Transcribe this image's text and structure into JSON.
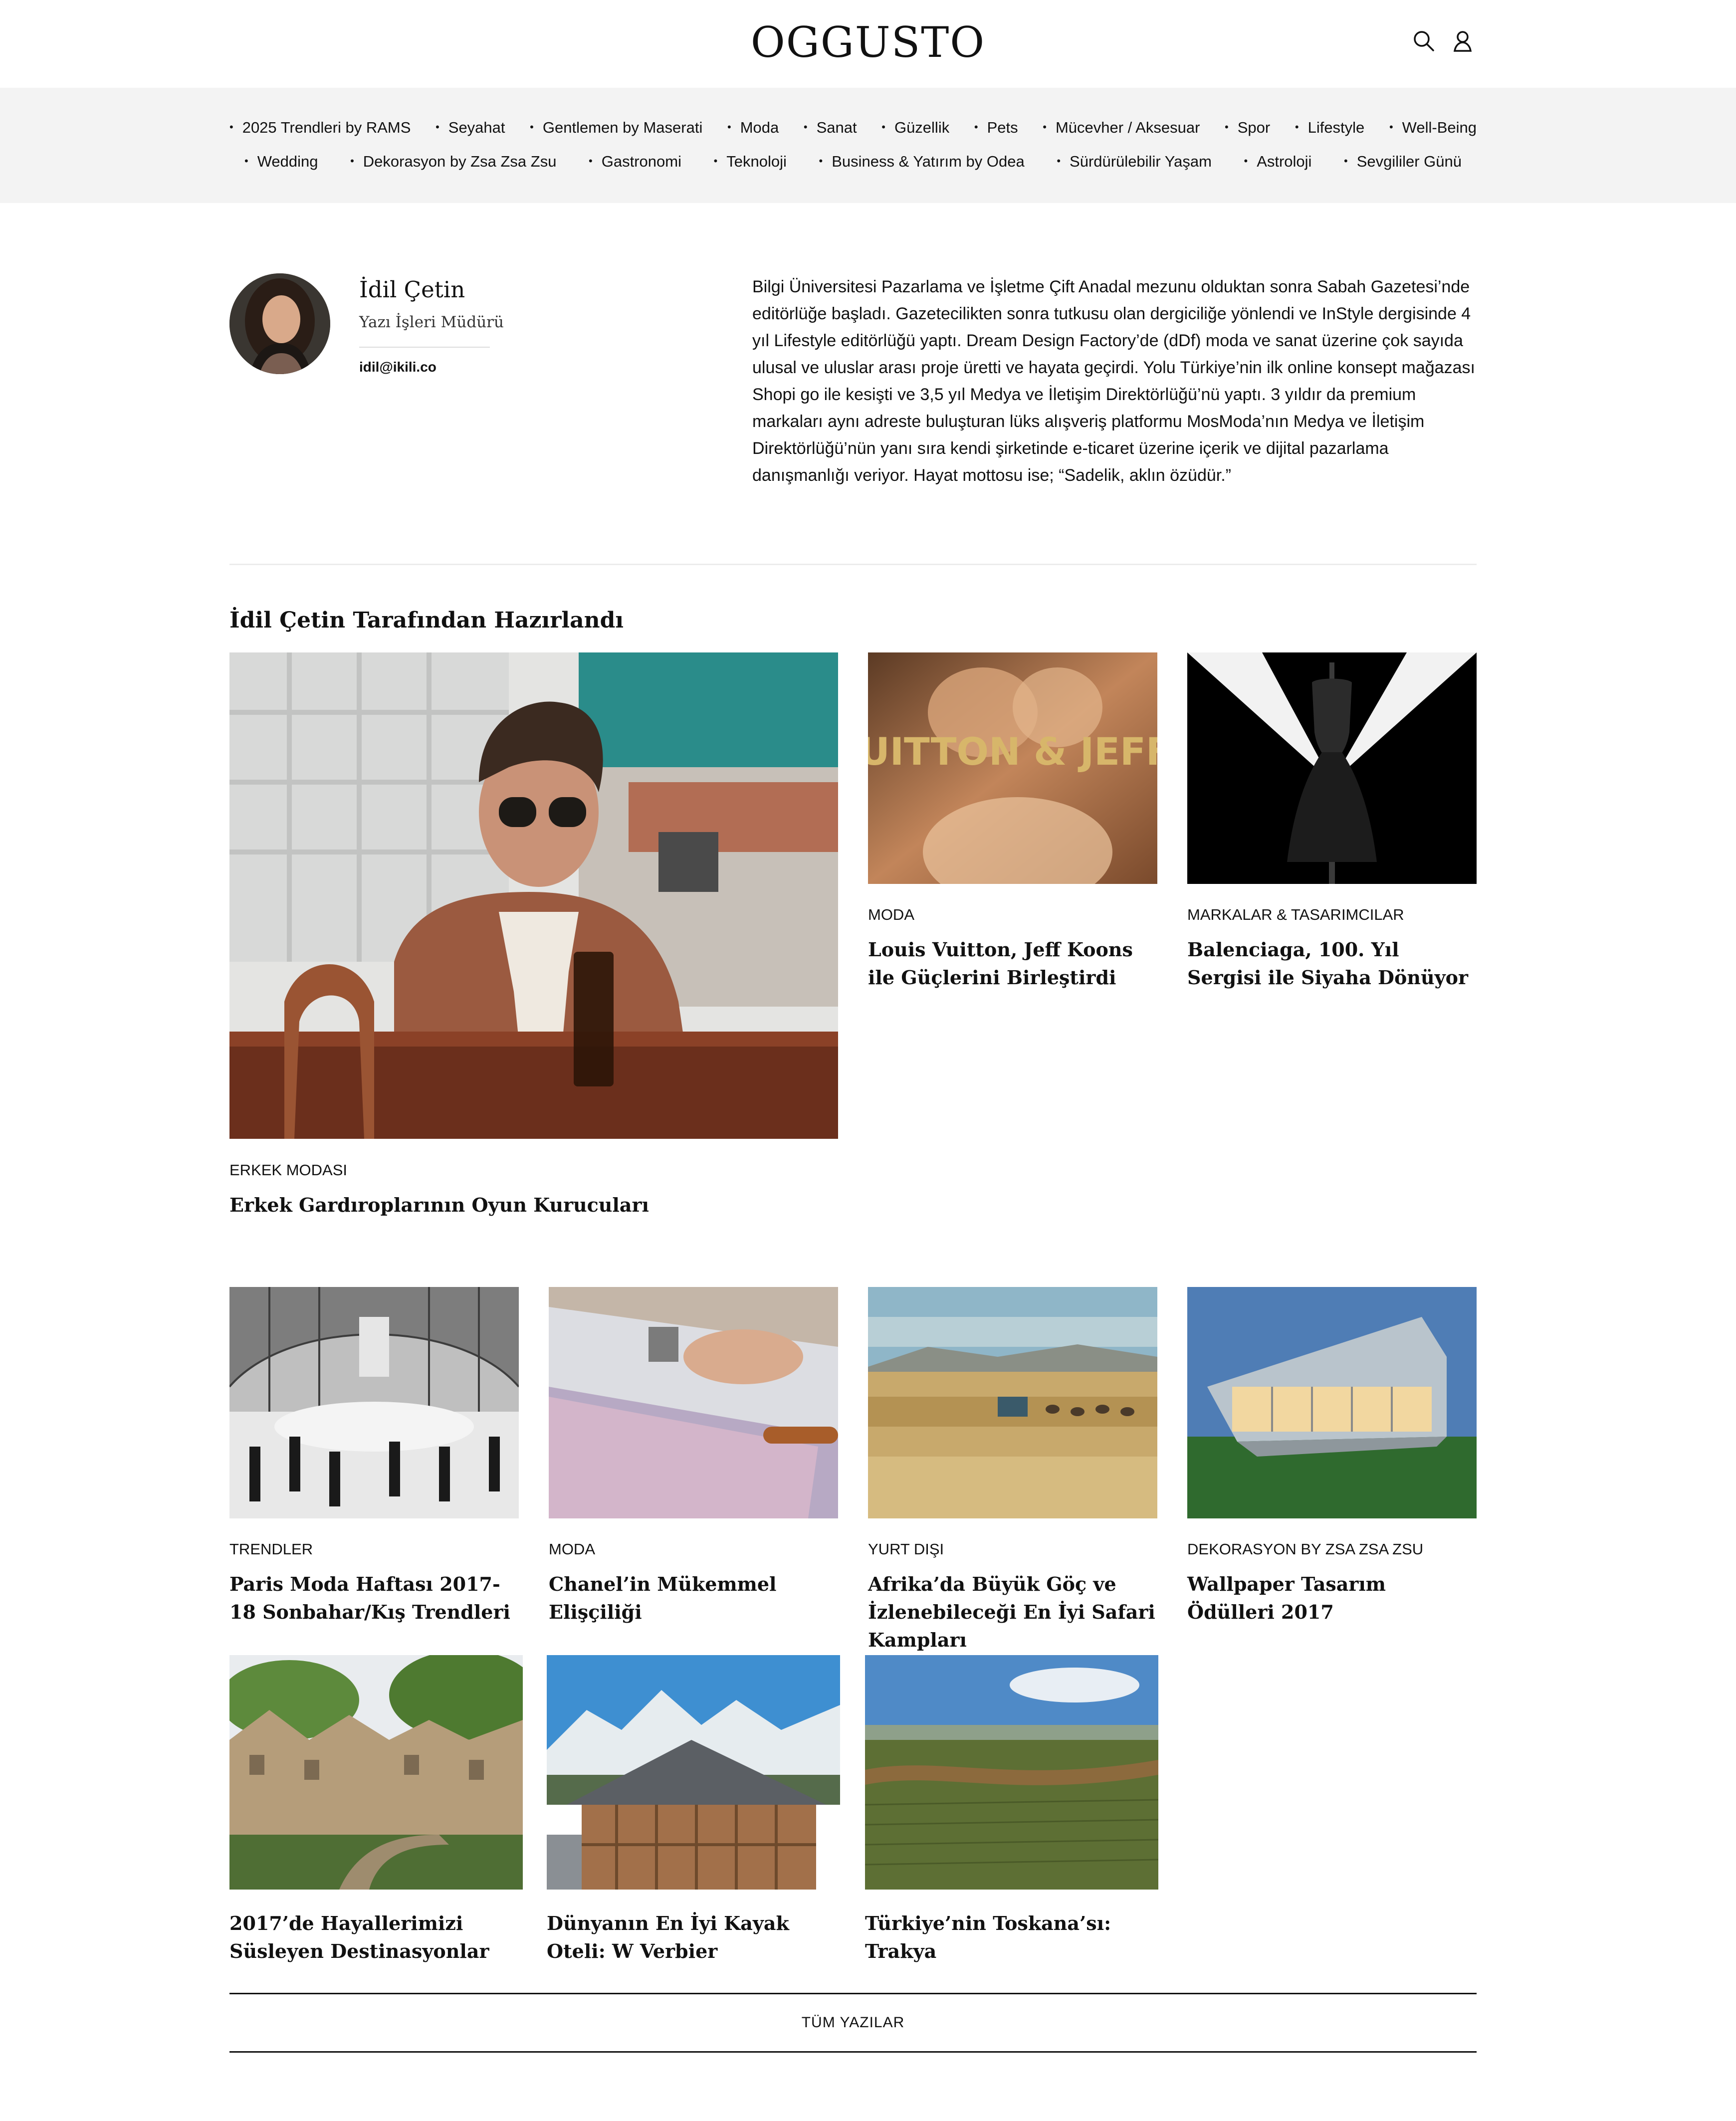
{
  "header": {
    "logo": "OGGUSTO",
    "icons": [
      "search-icon",
      "user-icon"
    ]
  },
  "nav": {
    "row1": [
      "2025 Trendleri by RAMS",
      "Seyahat",
      "Gentlemen by Maserati",
      "Moda",
      "Sanat",
      "Güzellik",
      "Pets",
      "Mücevher / Aksesuar",
      "Spor",
      "Lifestyle",
      "Well-Being"
    ],
    "row2": [
      "Wedding",
      "Dekorasyon by Zsa Zsa Zsu",
      "Gastronomi",
      "Teknoloji",
      "Business & Yatırım by Odea",
      "Sürdürülebilir Yaşam",
      "Astroloji",
      "Sevgililer Günü"
    ]
  },
  "author": {
    "name": "İdil Çetin",
    "role": "Yazı İşleri Müdürü",
    "email": "idil@ikili.co",
    "bio": "Bilgi Üniversitesi Pazarlama ve İşletme Çift Anadal mezunu olduktan sonra Sabah Gazetesi’nde editörlüğe başladı. Gazetecilikten sonra tutkusu olan dergiciliğe yönlendi ve InStyle dergisinde 4 yıl Lifestyle editörlüğü yaptı. Dream Design Factory’de (dDf) moda ve sanat üzerine çok sayıda ulusal ve uluslar arası proje üretti ve hayata geçirdi.  Yolu Türkiye’nin ilk online konsept mağazası Shopi go ile kesişti ve 3,5 yıl Medya ve İletişim Direktörlüğü’nü yaptı. 3 yıldır da premium markaları aynı adreste buluşturan lüks alışveriş platformu MosModa’nın Medya ve İletişim Direktörlüğü’nün yanı sıra kendi şirketinde e-ticaret üzerine içerik ve dijital pazarlama danışmanlığı veriyor. Hayat mottosu ise; “Sadelik, aklın özüdür.”"
  },
  "section": {
    "title": "İdil Çetin Tarafından Hazırlandı"
  },
  "featured": [
    {
      "category": "ERKEK MODASI",
      "title": "Erkek Gardıroplarının Oyun Kurucuları"
    },
    {
      "category": "MODA",
      "title": "Louis Vuitton, Jeff Koons ile Güçlerini Birleştirdi",
      "image_text": "LOUIS VUITTON & JEFF KOONS"
    },
    {
      "category": "MARKALAR & TASARIMCILAR",
      "title": "Balenciaga, 100. Yıl Sergisi ile Siyaha Dönüyor"
    }
  ],
  "grid1": [
    {
      "category": "TRENDLER",
      "title": "Paris Moda Haftası 2017-18 Sonbahar/Kış Trendleri"
    },
    {
      "category": "MODA",
      "title": "Chanel’in Mükemmel Elişçiliği"
    },
    {
      "category": "YURT DIŞI",
      "title": "Afrika’da Büyük Göç ve İzlenebileceği En İyi Safari Kampları"
    },
    {
      "category": "DEKORASYON BY ZSA ZSA ZSU",
      "title": "Wallpaper Tasarım Ödülleri 2017"
    }
  ],
  "grid2": [
    {
      "title": "2017’de Hayallerimizi Süsleyen Destinasyonlar"
    },
    {
      "title": "Dünyanın En İyi Kayak Oteli: W Verbier"
    },
    {
      "title": "Türkiye’nin Toskana’sı: Trakya"
    }
  ],
  "footer": {
    "all_posts": "TÜM YAZILAR"
  }
}
